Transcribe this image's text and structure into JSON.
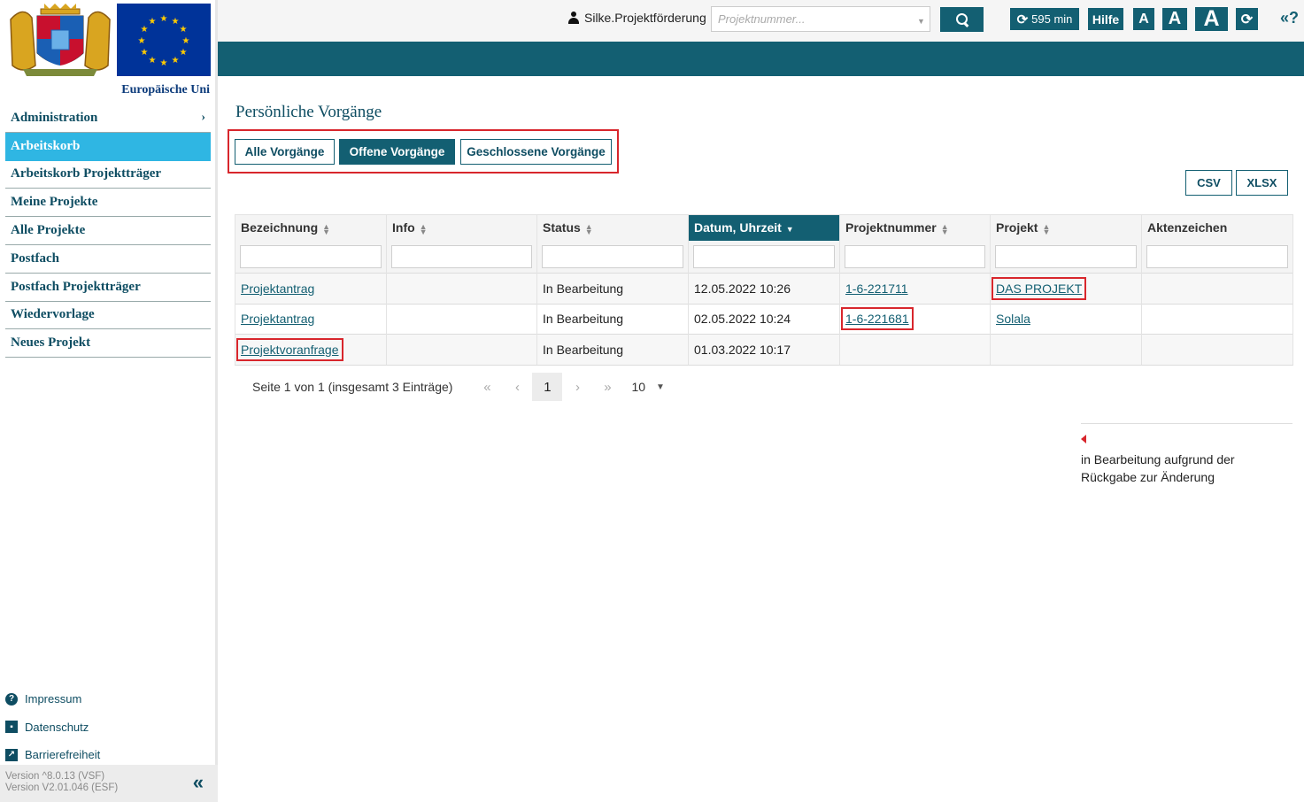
{
  "sidebar": {
    "eu_label": "Europäische Uni",
    "nav": [
      {
        "label": "Administration",
        "chevron": "›"
      },
      {
        "label": "Arbeitskorb"
      },
      {
        "label": "Arbeitskorb Projektträger"
      },
      {
        "label": "Meine Projekte"
      },
      {
        "label": "Alle Projekte"
      },
      {
        "label": "Postfach"
      },
      {
        "label": "Postfach Projektträger"
      },
      {
        "label": "Wiedervorlage"
      },
      {
        "label": "Neues Projekt"
      }
    ],
    "active_index": 1,
    "footer_links": [
      {
        "label": "Impressum",
        "icon": "question-circle-icon"
      },
      {
        "label": "Datenschutz",
        "icon": "id-card-icon"
      },
      {
        "label": "Barrierefreiheit",
        "icon": "external-link-icon"
      }
    ],
    "version_vsf": "Version ^8.0.13 (VSF)",
    "version_esf": "Version V2.01.046 (ESF)",
    "collapse_glyph": "«"
  },
  "topbar": {
    "user": "Silke.Projektförderung",
    "search_placeholder": "Projektnummer...",
    "timer": "595 min",
    "help": "Hilfe",
    "font_small": "A",
    "font_medium": "A",
    "font_large": "A",
    "refresh_glyph": "⟳",
    "toggle_help": "«?"
  },
  "main": {
    "title": "Persönliche Vorgänge",
    "filters": {
      "all": "Alle Vorgänge",
      "open": "Offene Vorgänge",
      "closed": "Geschlossene Vorgänge"
    },
    "export": {
      "csv": "CSV",
      "xlsx": "XLSX"
    },
    "table": {
      "columns": [
        "Bezeichnung",
        "Info",
        "Status",
        "Datum, Uhrzeit",
        "Projektnummer",
        "Projekt",
        "Aktenzeichen"
      ],
      "sorted_column": "Datum, Uhrzeit",
      "rows": [
        {
          "bezeichnung": "Projektantrag",
          "info": "",
          "status": "In Bearbeitung",
          "datum": "12.05.2022 10:26",
          "projektnummer": "1-6-221711",
          "projekt": "DAS PROJEKT",
          "aktenzeichen": ""
        },
        {
          "bezeichnung": "Projektantrag",
          "info": "",
          "status": "In Bearbeitung",
          "datum": "02.05.2022 10:24",
          "projektnummer": "1-6-221681",
          "projekt": "Solala",
          "aktenzeichen": ""
        },
        {
          "bezeichnung": "Projektvoranfrage",
          "info": "",
          "status": "In Bearbeitung",
          "datum": "01.03.2022 10:17",
          "projektnummer": "",
          "projekt": "",
          "aktenzeichen": ""
        }
      ]
    },
    "pager": {
      "summary": "Seite 1 von 1 (insgesamt 3 Einträge)",
      "first": "«",
      "prev": "‹",
      "current": "1",
      "next": "›",
      "last": "»",
      "page_size": "10"
    },
    "legend_text": "in Bearbeitung aufgrund der Rückgabe zur Änderung"
  },
  "colors": {
    "teal": "#135f72",
    "active_nav": "#2fb6e3",
    "highlight": "#d8262c"
  }
}
